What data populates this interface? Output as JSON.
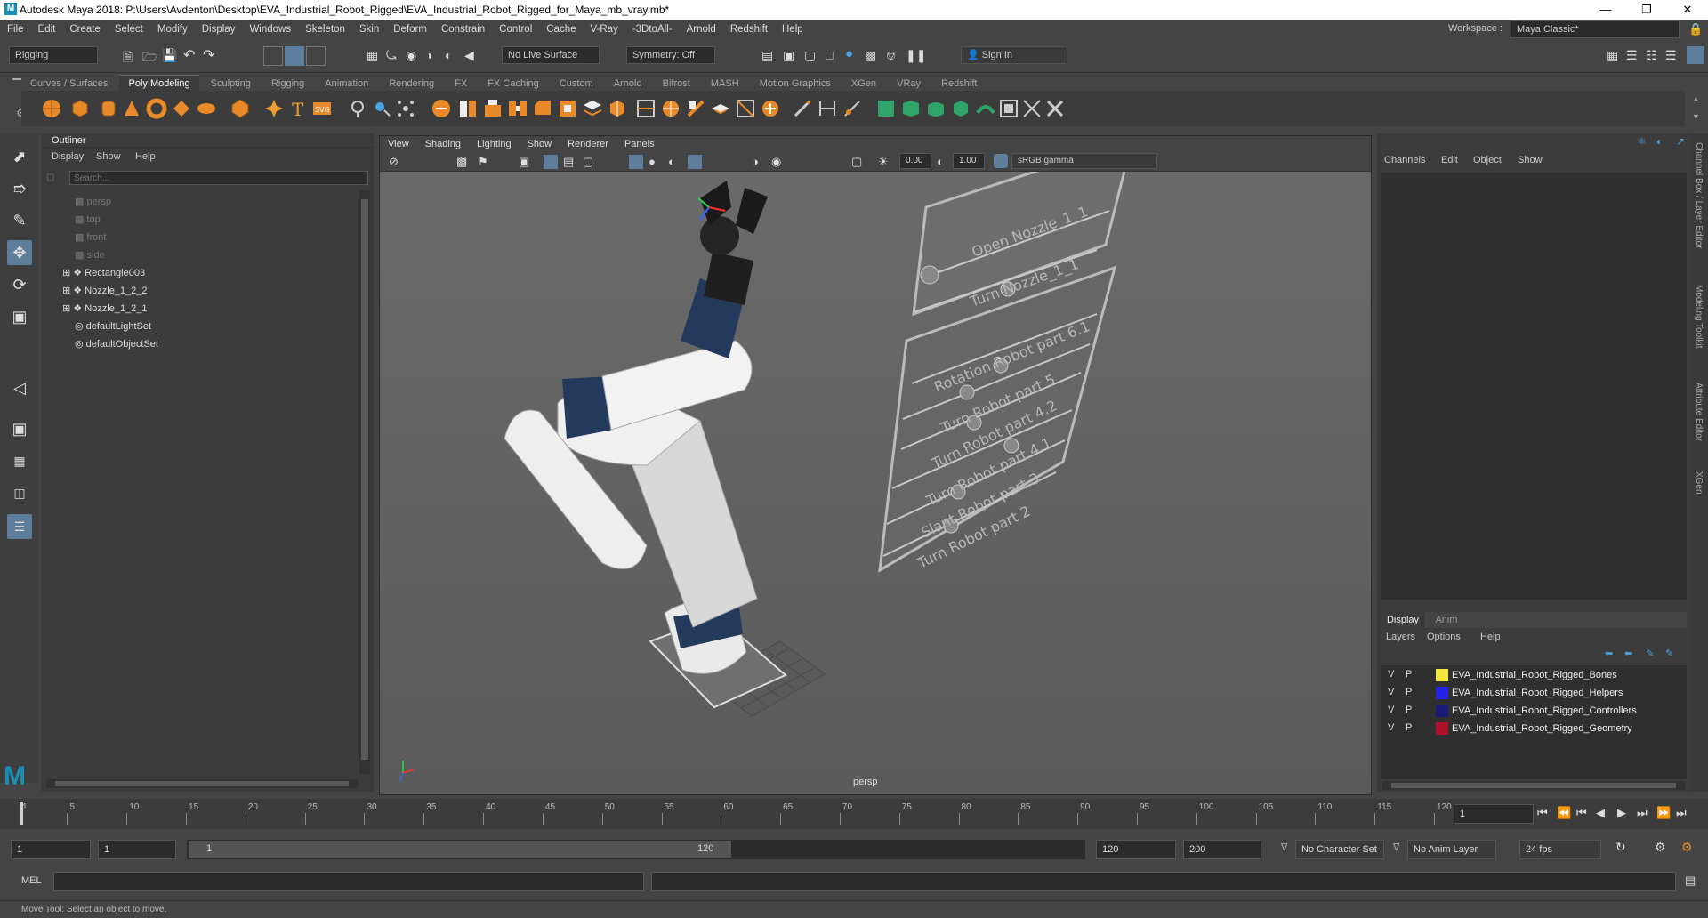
{
  "window": {
    "title": "Autodesk Maya 2018: P:\\Users\\Avdenton\\Desktop\\EVA_Industrial_Robot_Rigged\\EVA_Industrial_Robot_Rigged_for_Maya_mb_vray.mb*",
    "logo": "M"
  },
  "menu": [
    "File",
    "Edit",
    "Create",
    "Select",
    "Modify",
    "Display",
    "Windows",
    "Skeleton",
    "Skin",
    "Deform",
    "Constrain",
    "Control",
    "Cache",
    "V-Ray",
    "-3DtoAll-",
    "Arnold",
    "Redshift",
    "Help"
  ],
  "workspace": {
    "label": "Workspace :",
    "value": "Maya Classic*"
  },
  "status": {
    "mode": "Rigging",
    "live_surface": "No Live Surface",
    "symmetry": "Symmetry: Off",
    "sign_in": "Sign In"
  },
  "shelf_tabs": [
    "Curves / Surfaces",
    "Poly Modeling",
    "Sculpting",
    "Rigging",
    "Animation",
    "Rendering",
    "FX",
    "FX Caching",
    "Custom",
    "Arnold",
    "Bifrost",
    "MASH",
    "Motion Graphics",
    "XGen",
    "VRay",
    "Redshift"
  ],
  "outliner": {
    "title": "Outliner",
    "menu": [
      "Display",
      "Show",
      "Help"
    ],
    "search_placeholder": "Search...",
    "items": [
      {
        "label": "persp"
      },
      {
        "label": "top"
      },
      {
        "label": "front"
      },
      {
        "label": "side"
      },
      {
        "label": "Rectangle003"
      },
      {
        "label": "Nozzle_1_2_2"
      },
      {
        "label": "Nozzle_1_2_1"
      },
      {
        "label": "defaultLightSet"
      },
      {
        "label": "defaultObjectSet"
      }
    ]
  },
  "viewport": {
    "menu": [
      "View",
      "Shading",
      "Lighting",
      "Show",
      "Renderer",
      "Panels"
    ],
    "exposure": "0.00",
    "gamma": "1.00",
    "color_space": "sRGB gamma",
    "camera_label": "persp",
    "board_labels": [
      "Open Nozzle_1_1",
      "Turn Nozzle_1_1",
      "Rotation Robot part 6.1",
      "Turn Robot part 5",
      "Turn Robot part 4.2",
      "Turn Robot part 4.1",
      "Slant Robot part 3",
      "Turn Robot part 2"
    ]
  },
  "channel_box": {
    "menu": [
      "Channels",
      "Edit",
      "Object",
      "Show"
    ]
  },
  "layer_editor": {
    "tabs": [
      "Display",
      "Anim"
    ],
    "menu": [
      "Layers",
      "Options",
      "Help"
    ],
    "layers": [
      {
        "v": "V",
        "p": "P",
        "color": "#f5e642",
        "name": "EVA_Industrial_Robot_Rigged_Bones"
      },
      {
        "v": "V",
        "p": "P",
        "color": "#2323e6",
        "name": "EVA_Industrial_Robot_Rigged_Helpers"
      },
      {
        "v": "V",
        "p": "P",
        "color": "#1a1a7a",
        "name": "EVA_Industrial_Robot_Rigged_Controllers"
      },
      {
        "v": "V",
        "p": "P",
        "color": "#b0102a",
        "name": "EVA_Industrial_Robot_Rigged_Geometry"
      }
    ]
  },
  "side_tabs": [
    "Channel Box / Layer Editor",
    "Modeling Toolkit",
    "Attribute Editor",
    "XGen"
  ],
  "timeline": {
    "ticks": [
      "1",
      "5",
      "10",
      "15",
      "20",
      "25",
      "30",
      "35",
      "40",
      "45",
      "50",
      "55",
      "60",
      "65",
      "70",
      "75",
      "80",
      "85",
      "90",
      "95",
      "100",
      "105",
      "110",
      "115",
      "120"
    ],
    "current_frame": "1"
  },
  "range": {
    "start": "1",
    "anim_start": "1",
    "slider_start": "1",
    "slider_end": "120",
    "end": "120",
    "anim_end": "200",
    "character_set": "No Character Set",
    "anim_layer": "No Anim Layer",
    "fps": "24 fps"
  },
  "command": {
    "label": "MEL"
  },
  "help_line": "Move Tool: Select an object to move."
}
